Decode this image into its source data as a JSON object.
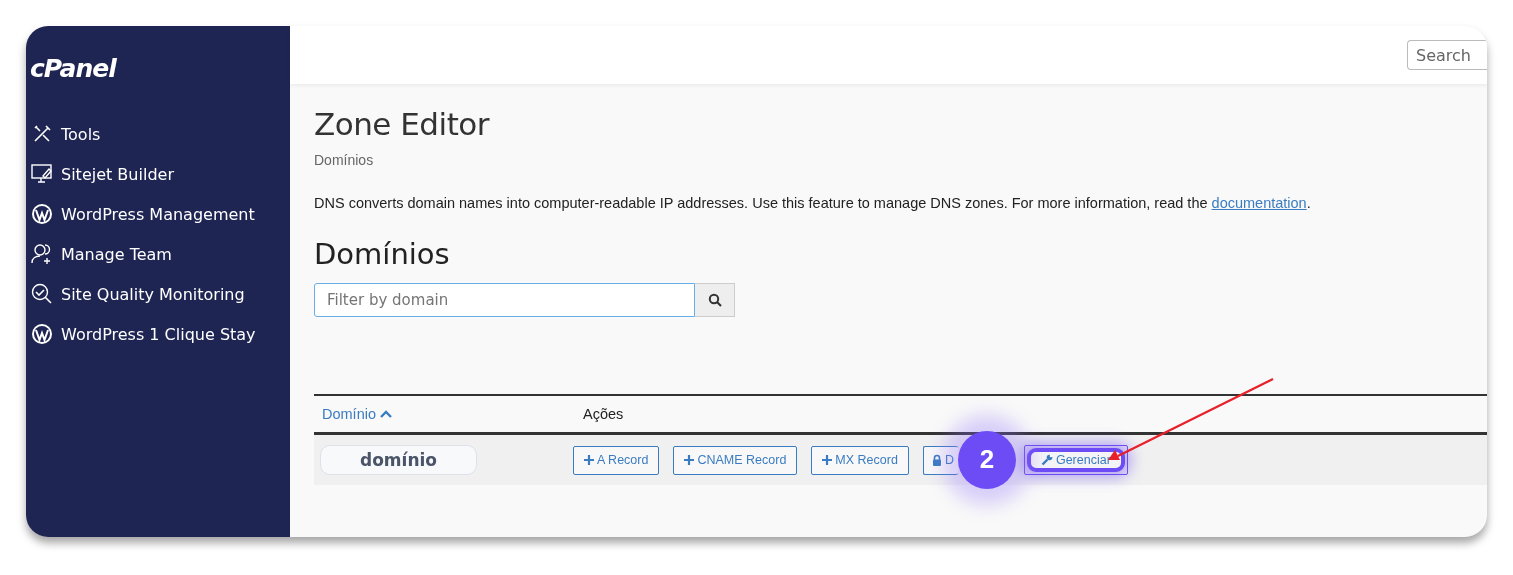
{
  "logo": "cPanel",
  "search": {
    "placeholder": "Search"
  },
  "sidebar": {
    "items": [
      {
        "label": "Tools",
        "kind": "tools"
      },
      {
        "label": "Sitejet Builder",
        "kind": "monitor"
      },
      {
        "label": "WordPress Management",
        "kind": "wordpress"
      },
      {
        "label": "Manage Team",
        "kind": "team"
      },
      {
        "label": "Site Quality Monitoring",
        "kind": "quality"
      },
      {
        "label": "WordPress 1 Clique Stay",
        "kind": "wordpress"
      }
    ]
  },
  "page": {
    "title": "Zone Editor",
    "breadcrumb": "Domínios",
    "description": "DNS converts domain names into computer-readable IP addresses. Use this feature to manage DNS zones. For more information, read the",
    "link": "documentation",
    "description_end": "."
  },
  "section": {
    "title": "Domínios",
    "filter": {
      "placeholder": "Filter by domain"
    }
  },
  "table": {
    "columns": [
      {
        "label": "Domínio",
        "sorted": true
      },
      {
        "label": "Ações",
        "sorted": false
      }
    ],
    "rows": [
      {
        "domain": "domínio",
        "actions": [
          {
            "label": "A Record",
            "kind": "add",
            "highlighted": false
          },
          {
            "label": "CNAME Record",
            "kind": "add",
            "highlighted": false
          },
          {
            "label": "MX Record",
            "kind": "add",
            "highlighted": false
          },
          {
            "label": "D",
            "kind": "lock",
            "highlighted": false
          },
          {
            "label": "Gerenciar",
            "kind": "manage",
            "highlighted": true
          }
        ]
      }
    ]
  },
  "annotation": {
    "badge": "2"
  }
}
